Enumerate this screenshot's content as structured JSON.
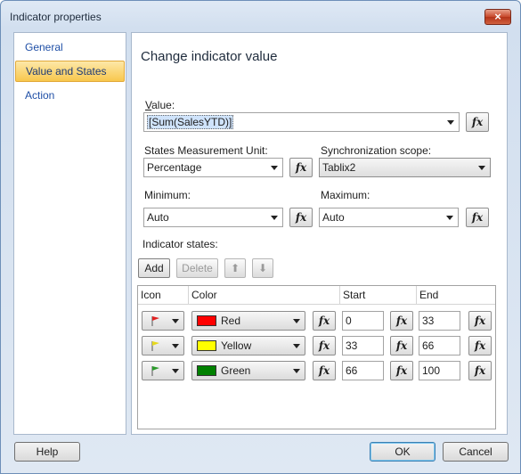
{
  "window": {
    "title": "Indicator properties",
    "close_glyph": "×"
  },
  "nav": {
    "items": [
      {
        "label": "General",
        "selected": false
      },
      {
        "label": "Value and States",
        "selected": true
      },
      {
        "label": "Action",
        "selected": false
      }
    ]
  },
  "page": {
    "heading": "Change indicator value",
    "value_label": "Value:",
    "value_text": "[Sum(SalesYTD)]",
    "states_unit_label": "States Measurement Unit:",
    "states_unit_value": "Percentage",
    "sync_scope_label": "Synchronization scope:",
    "sync_scope_value": "Tablix2",
    "minimum_label": "Minimum:",
    "minimum_value": "Auto",
    "maximum_label": "Maximum:",
    "maximum_value": "Auto",
    "indicator_states_label": "Indicator states:",
    "fx_label": "fx"
  },
  "toolbar": {
    "add_label": "Add",
    "delete_label": "Delete",
    "up_glyph": "⬆",
    "down_glyph": "⬇"
  },
  "grid": {
    "headers": [
      "Icon",
      "Color",
      "Start",
      "End"
    ],
    "rows": [
      {
        "icon": "red-flag-icon",
        "color_name": "Red",
        "color_hex": "#ff0000",
        "flag_hex": "#e02020",
        "start": "0",
        "end": "33"
      },
      {
        "icon": "yellow-flag-icon",
        "color_name": "Yellow",
        "color_hex": "#ffff00",
        "flag_hex": "#e6d81e",
        "start": "33",
        "end": "66"
      },
      {
        "icon": "green-flag-icon",
        "color_name": "Green",
        "color_hex": "#008000",
        "flag_hex": "#2a9a2a",
        "start": "66",
        "end": "100"
      }
    ]
  },
  "footer": {
    "help_label": "Help",
    "ok_label": "OK",
    "cancel_label": "Cancel"
  }
}
